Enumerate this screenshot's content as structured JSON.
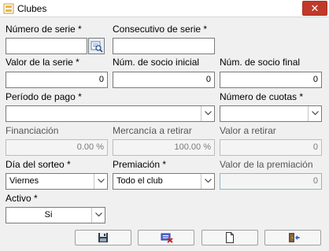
{
  "window": {
    "title": "Clubes",
    "close_symbol": "✕"
  },
  "form": {
    "numero_serie": {
      "label": "Número de serie *",
      "value": ""
    },
    "consecutivo_serie": {
      "label": "Consecutivo de serie *",
      "value": ""
    },
    "valor_serie": {
      "label": "Valor de la serie *",
      "value": "0"
    },
    "socio_inicial": {
      "label": "Núm. de socio inicial",
      "value": "0"
    },
    "socio_final": {
      "label": "Núm. de socio final",
      "value": "0"
    },
    "periodo_pago": {
      "label": "Período de pago *",
      "value": ""
    },
    "numero_cuotas": {
      "label": "Número de cuotas *",
      "value": ""
    },
    "financiacion": {
      "label": "Financiación",
      "value": "0.00 %"
    },
    "mercancia_retirar": {
      "label": "Mercancía a retirar",
      "value": "100.00 %"
    },
    "valor_retirar": {
      "label": "Valor a retirar",
      "value": "0"
    },
    "dia_sorteo": {
      "label": "Día del sorteo *",
      "value": "Viernes"
    },
    "premiacion": {
      "label": "Premiación *",
      "value": "Todo el club"
    },
    "valor_premiacion": {
      "label": "Valor de la premiación",
      "value": "0"
    },
    "activo": {
      "label": "Activo *",
      "value": "Si"
    }
  },
  "toolbar": {
    "buttons": [
      {
        "icon": "save-icon"
      },
      {
        "icon": "clear-icon"
      },
      {
        "icon": "new-document-icon"
      },
      {
        "icon": "exit-icon"
      }
    ]
  },
  "colors": {
    "close_button": "#c0392b",
    "background": "#f0f0f0"
  }
}
